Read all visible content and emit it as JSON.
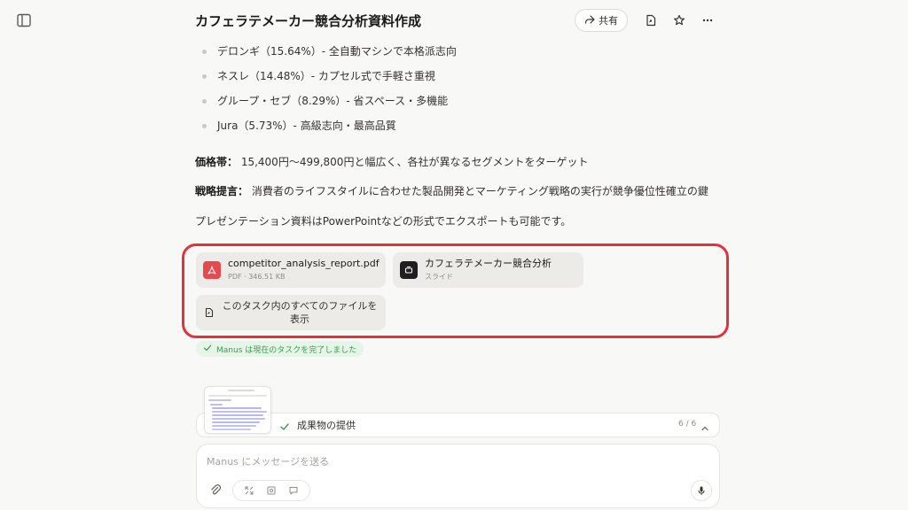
{
  "header": {
    "title": "カフェラテメーカー競合分析資料作成",
    "share_label": "共有"
  },
  "content": {
    "brands": [
      "デロンギ（15.64%）- 全自動マシンで本格派志向",
      "ネスレ（14.48%）- カプセル式で手軽さ重視",
      "グループ・セブ（8.29%）- 省スペース・多機能",
      "Jura（5.73%）- 高級志向・最高品質"
    ],
    "price_label": "価格帯：",
    "price_text": " 15,400円〜499,800円と幅広く、各社が異なるセグメントをターゲット",
    "strategy_label": "戦略提言：",
    "strategy_text": " 消費者のライフスタイルに合わせた製品開発とマーケティング戦略の実行が競争優位性確立の鍵",
    "export_note": "プレゼンテーション資料はPowerPointなどの形式でエクスポートも可能です。"
  },
  "files": {
    "pdf": {
      "name": "competitor_analysis_report.pdf",
      "meta": "PDF · 346.51 KB"
    },
    "slide": {
      "name": "カフェラテメーカー競合分析",
      "meta": "スライド"
    },
    "view_all": "このタスク内のすべてのファイルを表示"
  },
  "status": {
    "completed": "Manus は現在のタスクを完了しました"
  },
  "progress": {
    "label": "成果物の提供",
    "count": "6 / 6"
  },
  "composer": {
    "placeholder": "Manus にメッセージを送る"
  },
  "colors": {
    "highlight_border": "#e3323b",
    "success_text": "#3f9b53",
    "success_bg": "#e5f5e8",
    "pdf_icon": "#e5484d"
  }
}
